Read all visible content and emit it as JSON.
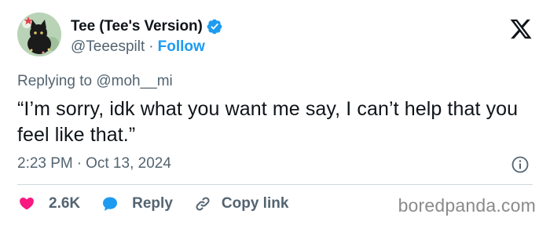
{
  "author": {
    "display_name": "Tee (Tee's Version)",
    "handle": "@Teeespilt",
    "separator": "·",
    "follow_label": "Follow"
  },
  "reply_context": {
    "prefix": "Replying to",
    "mention": "@moh__mi"
  },
  "tweet": {
    "text": "“I’m sorry, idk what you want me say, I can’t help that you feel like that.”",
    "time": "2:23 PM",
    "separator": "·",
    "date": "Oct 13, 2024"
  },
  "actions": {
    "like_count": "2.6K",
    "reply_label": "Reply",
    "copy_link_label": "Copy link"
  },
  "watermark": "boredpanda.com",
  "colors": {
    "link_blue": "#1d9bf0",
    "like_red": "#f91880",
    "secondary_text": "#536471",
    "divider": "#cfd9de"
  },
  "icons": [
    "x-logo-icon",
    "verified-badge-icon",
    "info-icon",
    "heart-icon",
    "reply-bubble-icon",
    "link-icon"
  ]
}
